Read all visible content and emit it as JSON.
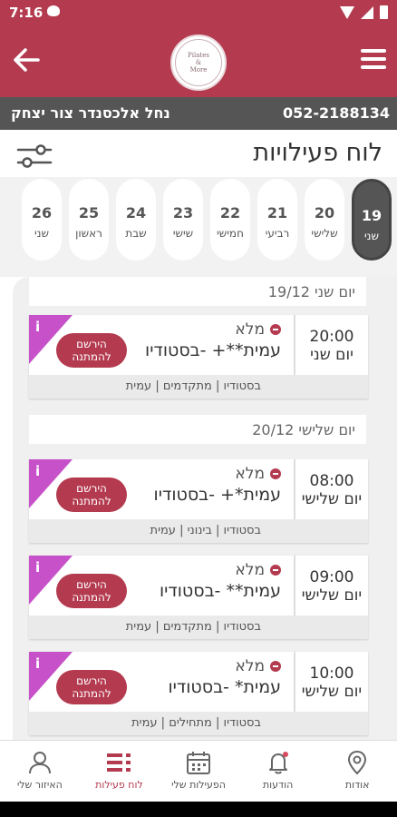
{
  "status_bar": {
    "time": "7:16"
  },
  "header": {
    "logo_lines": [
      "Pilates",
      "&",
      "More"
    ],
    "colors": {
      "primary": "#b43b4f",
      "info_bar": "#555555",
      "info_tag": "#c651c9"
    }
  },
  "info_bar": {
    "phone": "052-2188134",
    "name": "נחל אלכסנדר צור יצחק"
  },
  "page_title": "לוח פעילויות",
  "days": [
    {
      "num": "19",
      "name": "שני",
      "selected": true
    },
    {
      "num": "20",
      "name": "שלישי"
    },
    {
      "num": "21",
      "name": "רביעי"
    },
    {
      "num": "22",
      "name": "חמישי"
    },
    {
      "num": "23",
      "name": "שישי"
    },
    {
      "num": "24",
      "name": "שבת"
    },
    {
      "num": "25",
      "name": "ראשון"
    },
    {
      "num": "26",
      "name": "שני"
    }
  ],
  "sections": [
    {
      "date": "יום שני 19/12",
      "activities": [
        {
          "time": "20:00",
          "day": "יום שני",
          "status": "מלא",
          "title": "עמית**+ -בסטודיו",
          "button": "הירשם להמתנה",
          "tags": "בסטודיו | מתקדמים | עמית"
        }
      ]
    },
    {
      "date": "יום שלישי 20/12",
      "activities": [
        {
          "time": "08:00",
          "day": "יום שלישי",
          "status": "מלא",
          "title": "עמית*+ -בסטודיו",
          "button": "הירשם להמתנה",
          "tags": "בסטודיו | בינוני | עמית"
        },
        {
          "time": "09:00",
          "day": "יום שלישי",
          "status": "מלא",
          "title": "עמית** -בסטודיו",
          "button": "הירשם להמתנה",
          "tags": "בסטודיו | מתקדמים | עמית"
        },
        {
          "time": "10:00",
          "day": "יום שלישי",
          "status": "מלא",
          "title": "עמית* -בסטודיו",
          "button": "הירשם להמתנה",
          "tags": "בסטודיו | מתחילים | עמית"
        }
      ]
    }
  ],
  "bottom_nav": [
    {
      "label": "אודות",
      "icon": "location-pin-icon"
    },
    {
      "label": "הודעות",
      "icon": "bell-icon"
    },
    {
      "label": "הפעילות שלי",
      "icon": "calendar-icon"
    },
    {
      "label": "לוח פעילות",
      "icon": "list-icon",
      "active": true
    },
    {
      "label": "האיזור שלי",
      "icon": "user-icon"
    }
  ]
}
